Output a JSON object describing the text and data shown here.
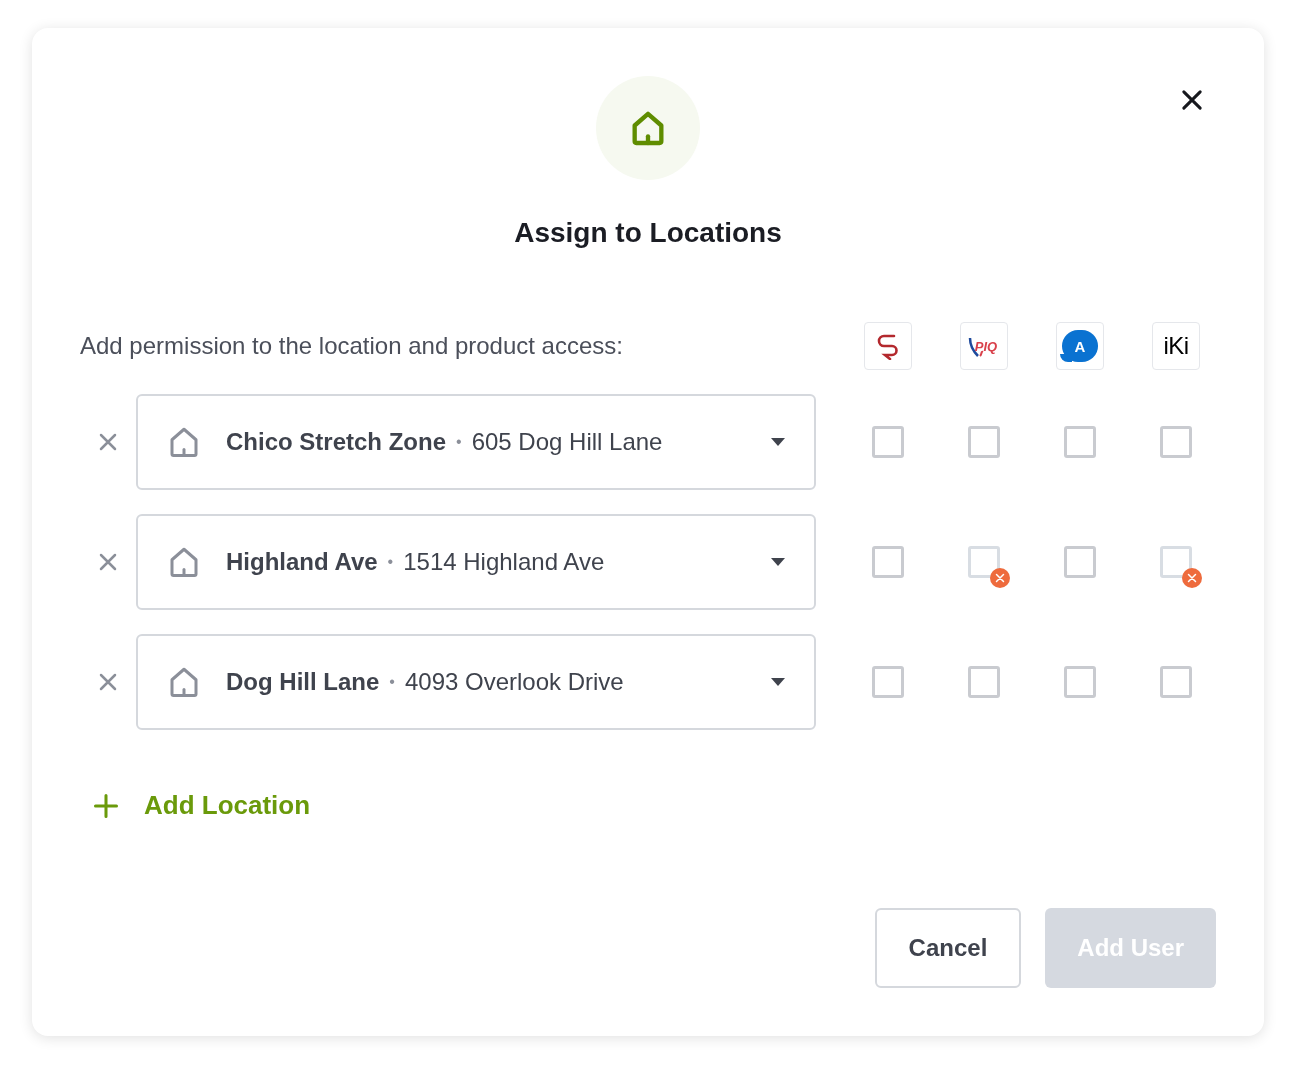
{
  "dialog": {
    "title": "Assign to Locations",
    "prompt": "Add permission to the location and product access:"
  },
  "products": [
    {
      "kind": "swirl"
    },
    {
      "kind": "piq",
      "label": "PIQ"
    },
    {
      "kind": "bubble",
      "label": "A"
    },
    {
      "kind": "wordmark",
      "label": "iKi"
    }
  ],
  "locations": [
    {
      "name": "Chico Stretch Zone",
      "separator": "•",
      "address": "605 Dog Hill Lane",
      "access": [
        {
          "checked": false,
          "unavailable": false
        },
        {
          "checked": false,
          "unavailable": false
        },
        {
          "checked": false,
          "unavailable": false
        },
        {
          "checked": false,
          "unavailable": false
        }
      ]
    },
    {
      "name": "Highland Ave",
      "separator": "•",
      "address": "1514 Highland Ave",
      "access": [
        {
          "checked": false,
          "unavailable": false
        },
        {
          "checked": false,
          "unavailable": true
        },
        {
          "checked": false,
          "unavailable": false
        },
        {
          "checked": false,
          "unavailable": true
        }
      ]
    },
    {
      "name": "Dog Hill Lane",
      "separator": "•",
      "address": "4093 Overlook Drive",
      "access": [
        {
          "checked": false,
          "unavailable": false
        },
        {
          "checked": false,
          "unavailable": false
        },
        {
          "checked": false,
          "unavailable": false
        },
        {
          "checked": false,
          "unavailable": false
        }
      ]
    }
  ],
  "add_location": {
    "label": "Add Location"
  },
  "buttons": [
    {
      "kind": "secondary",
      "label": "Cancel",
      "disabled": false
    },
    {
      "kind": "primary",
      "label": "Add User",
      "disabled": true
    }
  ]
}
